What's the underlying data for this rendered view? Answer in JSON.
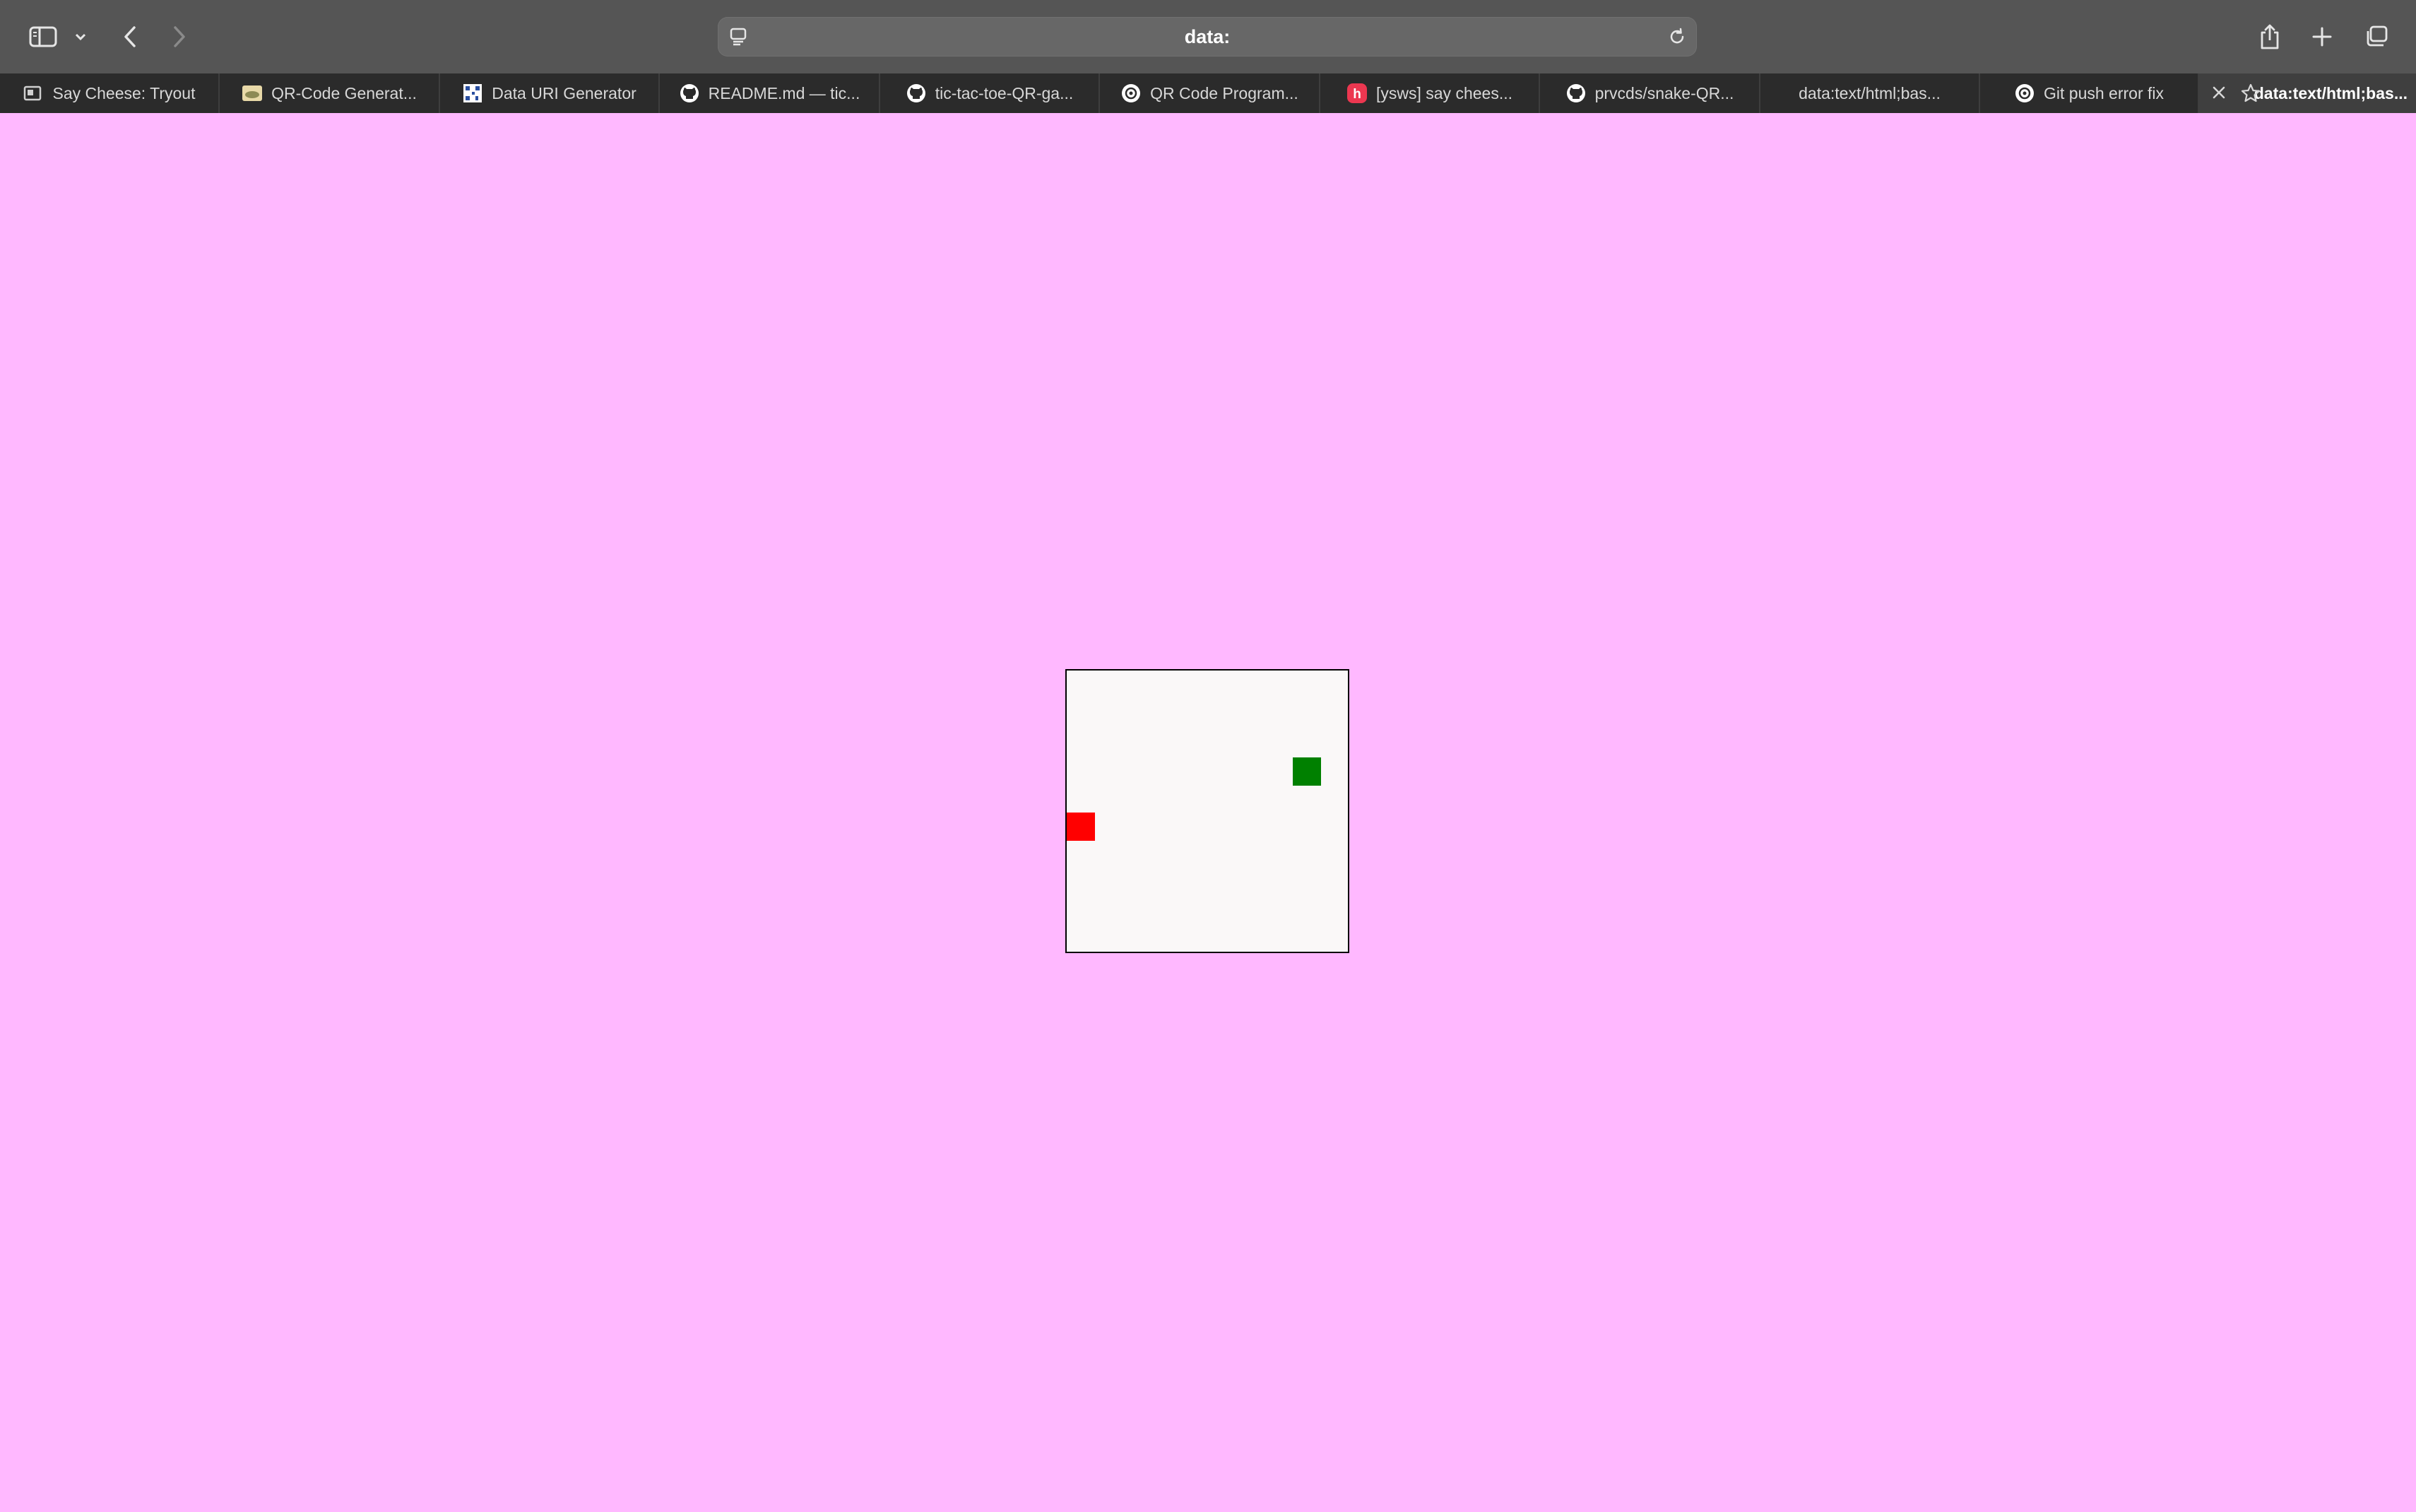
{
  "browser": {
    "address": "data:",
    "toolbar": {
      "sidebar_icon": "sidebar-icon",
      "back_icon": "chevron-left-icon",
      "forward_icon": "chevron-right-icon",
      "share_icon": "share-icon",
      "new_tab_icon": "plus-icon",
      "tab_overview_icon": "tabs-overview-icon"
    },
    "tabs": [
      {
        "label": "Say Cheese: Tryout",
        "icon": "video-favicon"
      },
      {
        "label": "QR-Code Generat...",
        "icon": "image-favicon"
      },
      {
        "label": "Data URI Generator",
        "icon": "qr-favicon"
      },
      {
        "label": "README.md — tic...",
        "icon": "github-favicon"
      },
      {
        "label": "tic-tac-toe-QR-ga...",
        "icon": "github-favicon"
      },
      {
        "label": "QR Code Program...",
        "icon": "openai-favicon"
      },
      {
        "label": "[ysws] say chees...",
        "icon": "hackclub-favicon",
        "icon_text": "h"
      },
      {
        "label": "prvcds/snake-QR...",
        "icon": "github-favicon"
      },
      {
        "label": "data:text/html;bas...",
        "icon": ""
      },
      {
        "label": "Git push error fix",
        "icon": "openai-favicon"
      },
      {
        "label": "data:text/html;bas...",
        "icon": "star-icon",
        "active": true
      }
    ]
  },
  "colors": {
    "page_background": "#ffb8ff",
    "board_background": "#faf8f8",
    "food": "#008000",
    "snake": "#ff0000"
  }
}
